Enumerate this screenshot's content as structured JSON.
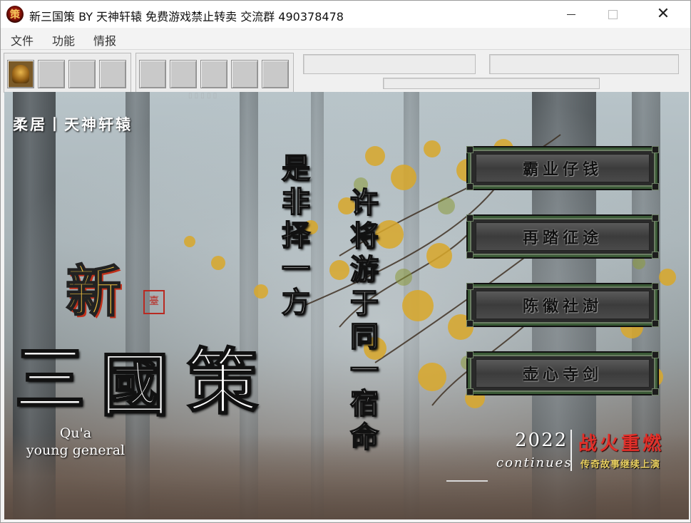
{
  "window": {
    "title": "新三国策 BY 天神轩辕 免费游戏禁止转卖 交流群 490378478",
    "app_icon_glyph": "策",
    "controls": {
      "close_glyph": "✕"
    }
  },
  "menubar": {
    "items": [
      "文件",
      "功能",
      "情报"
    ]
  },
  "toolbar": {
    "group1_buttons": [
      "helmet",
      "",
      "",
      ""
    ],
    "group2_buttons": [
      "",
      "",
      "",
      "",
      ""
    ]
  },
  "scene": {
    "studio_label": "柔居丨天神轩辕",
    "logo_xin": "新",
    "logo_seal": "臺",
    "logo_san": "三",
    "logo_guo": "國",
    "logo_ce": "策",
    "sub_en_line1": "Qu'a",
    "sub_en_line2": "young general",
    "vertical_line1": "是非择一方",
    "vertical_line2": "许将游于同一宿命",
    "menu_buttons": [
      "霸业仔钱",
      "再踏征途",
      "陈徽社澍",
      "壶心寺剑"
    ],
    "year": "2022",
    "continues": "continues",
    "warfire": "战火重燃",
    "legend": "传奇故事继续上演"
  },
  "colors": {
    "title_bg": "#ffffff",
    "menu_bg": "#f3f3f3",
    "toolbar_btn": "#c9c9c9",
    "button_frame": "#3a5a36",
    "warfire_red": "#e0302a",
    "legend_gold": "#e9d060"
  }
}
